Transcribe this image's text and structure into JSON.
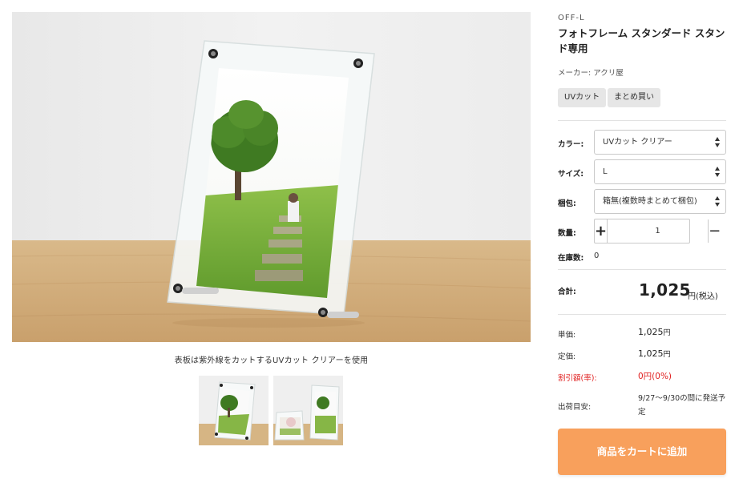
{
  "product": {
    "sku": "OFF-L",
    "title": "フォトフレーム スタンダード スタンド専用",
    "maker": "メーカー: アクリ屋",
    "tags": [
      "UVカット",
      "まとめ買い"
    ]
  },
  "gallery": {
    "caption": "表板は紫外線をカットするUVカット クリアーを使用"
  },
  "options": {
    "color_label": "カラー:",
    "color_value": "UVカット クリアー",
    "size_label": "サイズ:",
    "size_value": "L",
    "packing_label": "梱包:",
    "packing_value": "箱無(複数時まとめて梱包)",
    "qty_label": "数量:",
    "qty_value": "1",
    "qty_plus": "+",
    "qty_minus": "−",
    "stock_label": "在庫数:",
    "stock_value": "0"
  },
  "price": {
    "total_label": "合計:",
    "total_value": "1,025",
    "total_unit": "円(税込)",
    "unit_label": "単価:",
    "unit_value": "1,025",
    "list_label": "定価:",
    "list_value": "1,025",
    "yen": "円",
    "discount_label": "割引額(率):",
    "discount_value": "0円(0%)",
    "ship_label": "出荷目安:",
    "ship_value": "9/27〜9/30の間に発送予定"
  },
  "cart": {
    "button_label": "商品をカートに追加"
  },
  "colors": {
    "accent": "#f8a05c",
    "discount": "#e02020",
    "tag_bg": "#e6e6e6"
  }
}
